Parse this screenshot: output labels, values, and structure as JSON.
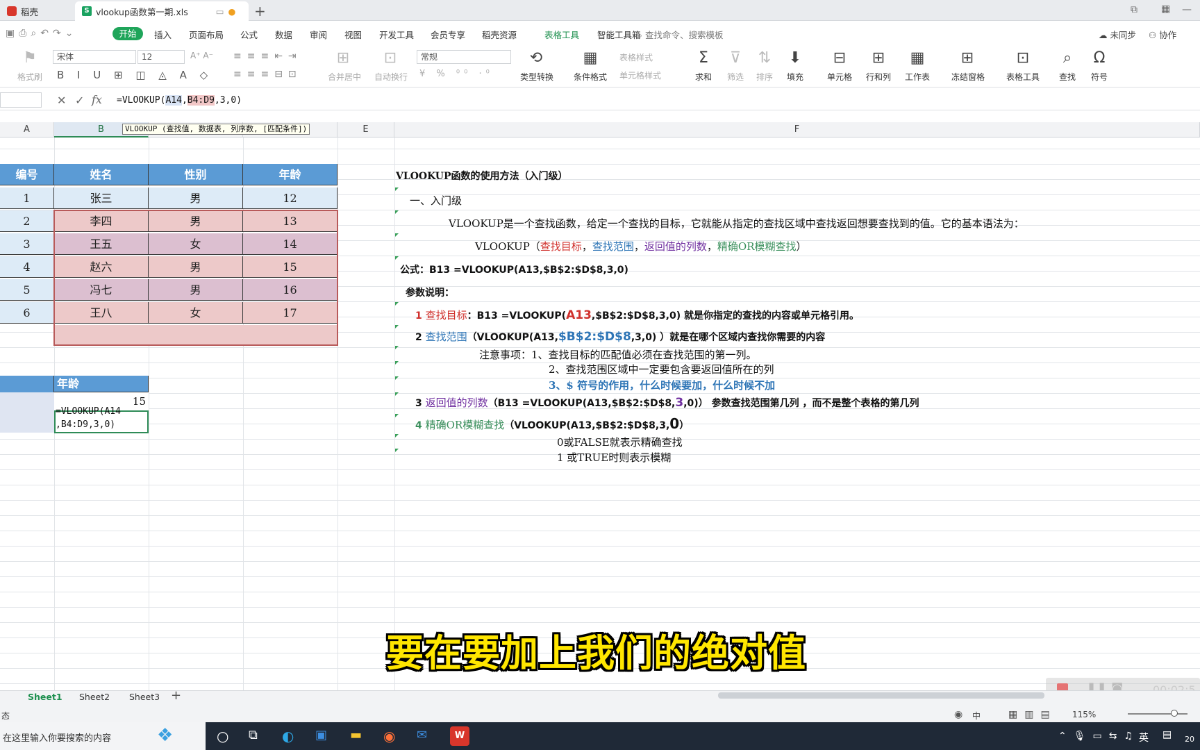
{
  "tabs": {
    "home": "稻壳",
    "file": "vlookup函数第一期.xls"
  },
  "menu": [
    "开始",
    "插入",
    "页面布局",
    "公式",
    "数据",
    "审阅",
    "视图",
    "开发工具",
    "会员专享",
    "稻壳资源",
    "表格工具",
    "智能工具箱"
  ],
  "search_cmd": "查找命令、搜索模板",
  "top_right": {
    "sync": "未同步",
    "collab": "协作"
  },
  "toolbar": {
    "format_brush": "格式刷",
    "font_name": "宋体",
    "font_size": "12",
    "number_format": "常规",
    "merge": "合并居中",
    "wrap": "自动换行",
    "type_convert": "类型转换",
    "cond_format": "条件格式",
    "table_style": "表格样式",
    "cell_style": "单元格样式",
    "sum": "求和",
    "filter": "筛选",
    "sort": "排序",
    "fill": "填充",
    "cell": "单元格",
    "rowcol": "行和列",
    "sheet": "工作表",
    "freeze": "冻结窗格",
    "tabletools": "表格工具",
    "find": "查找",
    "symbol": "符号"
  },
  "formula": {
    "prefix": "=VLOOKUP(",
    "a": "A14",
    "sep": ",",
    "b": "B4:D9",
    "suffix": ",3,0)",
    "tooltip": "VLOOKUP (查找值, 数据表, 列序数, [匹配条件])"
  },
  "columns": [
    "A",
    "B",
    "C",
    "D",
    "E",
    "F"
  ],
  "table": {
    "headers": [
      "编号",
      "姓名",
      "性别",
      "年龄"
    ],
    "rows": [
      [
        "1",
        "张三",
        "男",
        "12"
      ],
      [
        "2",
        "李四",
        "男",
        "13"
      ],
      [
        "3",
        "王五",
        "女",
        "14"
      ],
      [
        "4",
        "赵六",
        "男",
        "15"
      ],
      [
        "5",
        "冯七",
        "男",
        "16"
      ],
      [
        "6",
        "王八",
        "女",
        "17"
      ]
    ]
  },
  "lookup": {
    "header": "年龄",
    "value": "15",
    "edit_line1": "=VLOOKUP(A14",
    "edit_line2": ",B4:D9,3,0)"
  },
  "notes": {
    "title": "VLOOKUP函数的使用方法（入门级）",
    "section1": "一、入门级",
    "intro": "VLOOKUP是一个查找函数，给定一个查找的目标，它就能从指定的查找区域中查找返回想要查找到的值。它的基本语法为：",
    "syntax": {
      "fn": "VLOOKUP（",
      "p1": "查找目标",
      "c1": "，",
      "p2": "查找范围",
      "c2": "，",
      "p3": "返回值的列数",
      "c3": "，",
      "p4": "精确OR模糊查找",
      "end": "）"
    },
    "formula_line": "公式：B13 =VLOOKUP(A13,$B$2:$D$8,3,0)",
    "params": "参数说明：",
    "p1": {
      "num": "1 ",
      "label": "查找目标",
      "pre": "：B13 =VLOOKUP(",
      "hl": "A13",
      "post": ",$B$2:$D$8,3,0)  就是你指定的查找的内容或单元格引用。"
    },
    "p2": {
      "num": "2 ",
      "label": "查找范围",
      "pre": "（VLOOKUP(A13,",
      "hl": "$B$2:$D$8",
      "post": ",3,0) ）就是在哪个区域内查找你需要的内容"
    },
    "note1": "注意事项：1、查找目标的匹配值必须在查找范围的第一列。",
    "note2": "2、查找范围区域中一定要包含要返回值所在的列",
    "note3": "3、$ 符号的作用，什么时候要加，什么时候不加",
    "p3": {
      "num": "3  ",
      "label": "返回值的列数",
      "pre": "（B13 =VLOOKUP(A13,$B$2:$D$8,",
      "hl": "3",
      "post": ",0)）  参数查找范围第几列 ，而不是整个表格的第几列"
    },
    "p4": {
      "num": "4 ",
      "label": "精确OR模糊查找",
      "pre": "（VLOOKUP(A13,$B$2:$D$8,3,",
      "hl": "0",
      "post": "）"
    },
    "exact": "0或FALSE就表示精确查找",
    "fuzzy": "1  或TRUE时则表示模糊"
  },
  "sheets": [
    "Sheet1",
    "Sheet2",
    "Sheet3"
  ],
  "status": {
    "left": "态",
    "zoom": "115%",
    "lang": "中",
    "timer": "00:02:5"
  },
  "taskbar": {
    "search": "在这里输入你要搜索的内容",
    "ime": "英",
    "year": "20"
  },
  "subtitle": "要在要加上我们的绝对值"
}
